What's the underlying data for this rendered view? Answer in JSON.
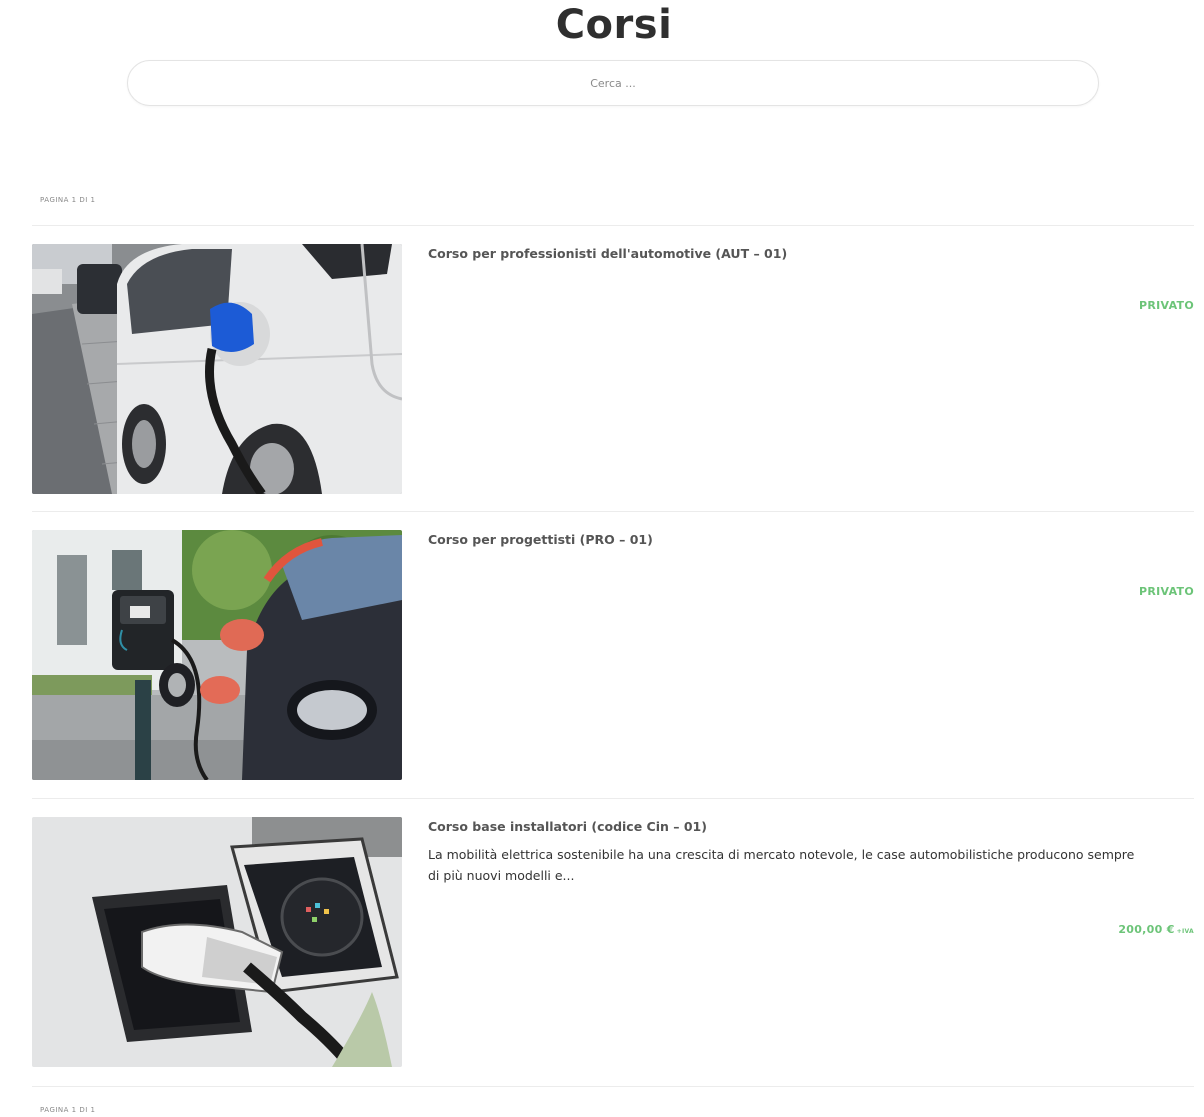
{
  "page": {
    "title": "Corsi"
  },
  "search": {
    "placeholder": "Cerca ..."
  },
  "pagination": {
    "top": "PAGINA 1 DI 1",
    "bottom": "PAGINA 1 DI 1"
  },
  "courses": [
    {
      "title": "Corso per professionisti dell'automotive (AUT – 01)",
      "status": "PRIVATO",
      "image": "blue-charger-on-white-car"
    },
    {
      "title": "Corso per progettisti (PRO – 01)",
      "status": "PRIVATO",
      "image": "wallbox-charging-station"
    },
    {
      "title": "Corso base installatori (codice Cin – 01)",
      "description": "La mobilità elettrica sostenibile ha una crescita di mercato notevole, le case automobilistiche producono sempre di più nuovi modelli e...",
      "price": "200,00 €",
      "price_suffix": "+IVA",
      "image": "charging-plug-closeup"
    }
  ],
  "colors": {
    "accent": "#6cc478",
    "title": "#2f2f2f"
  }
}
